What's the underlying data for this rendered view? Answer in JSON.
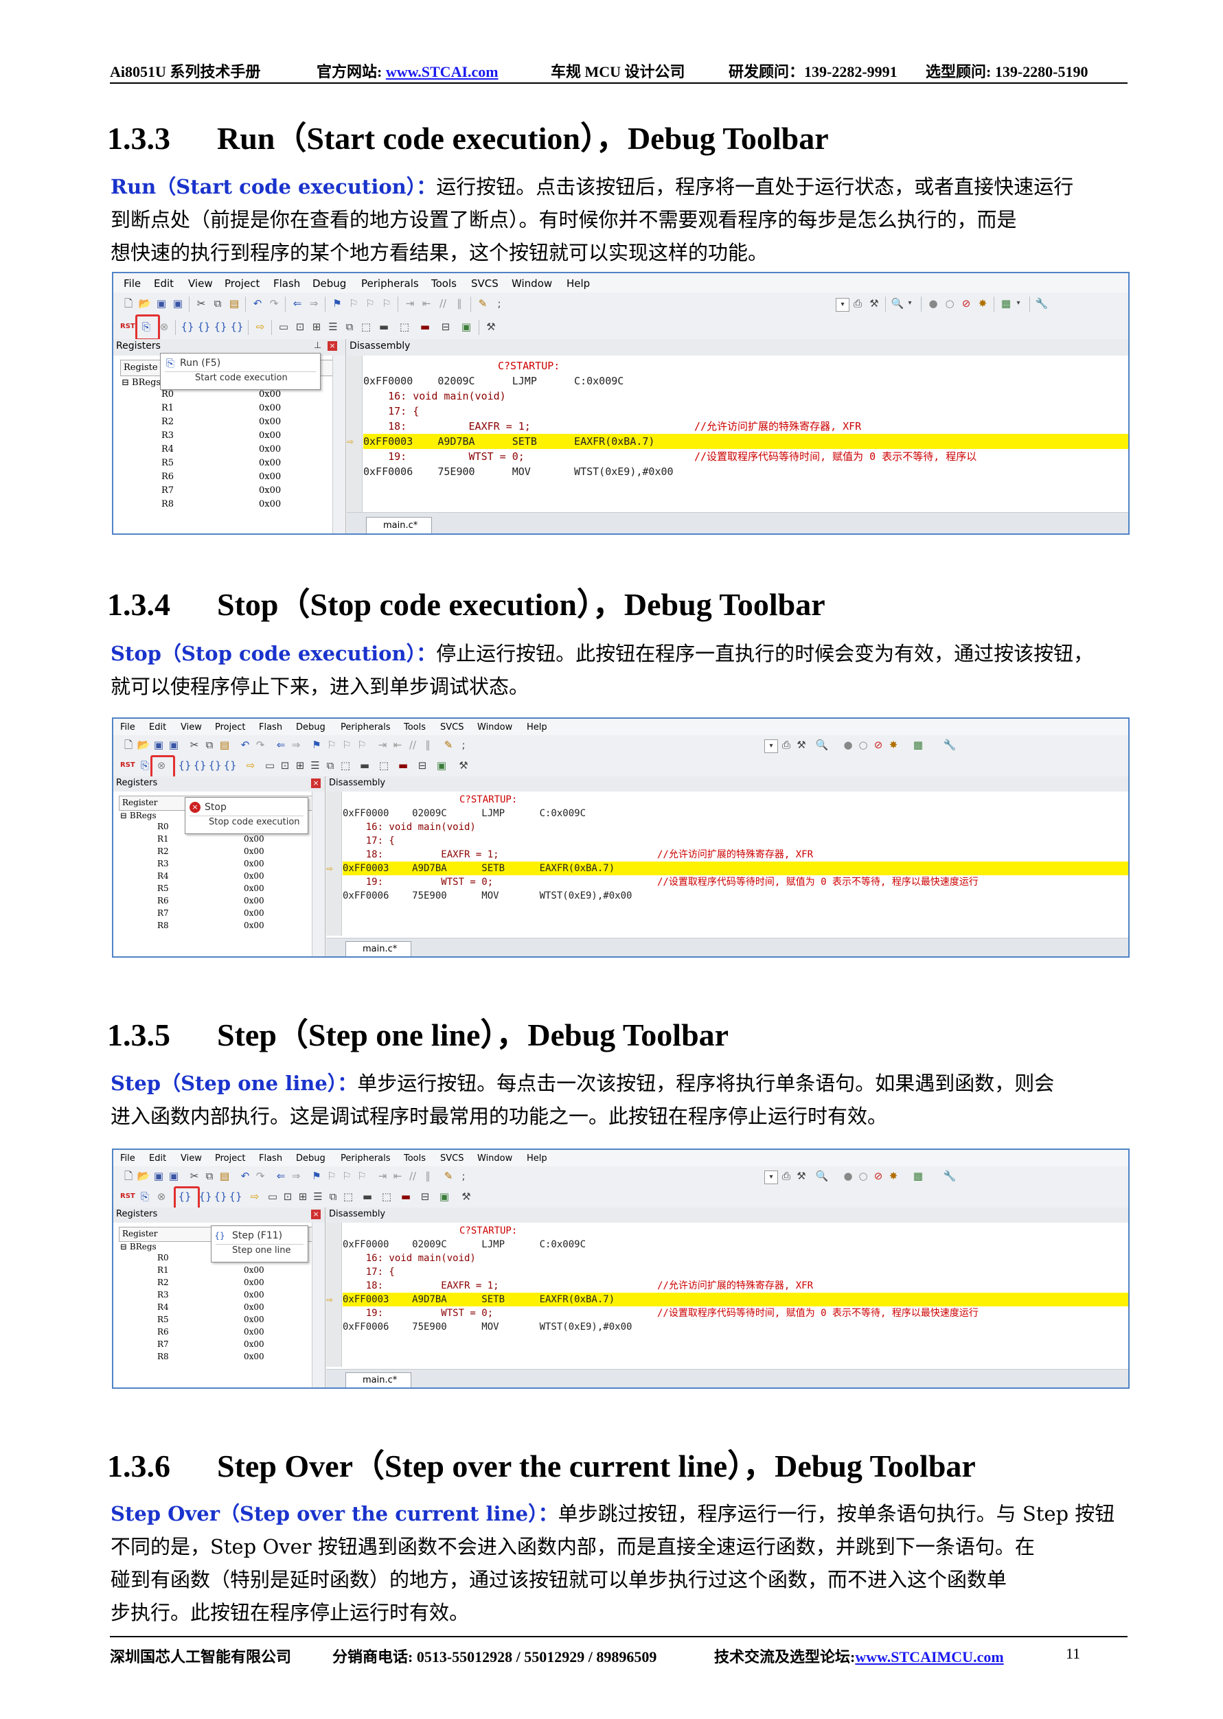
{
  "header": {
    "left": "Ai8051U 系列技术手册",
    "site_label": "官方网站: ",
    "site_link": "www.STCAI.com",
    "company": "车规 MCU 设计公司",
    "rd": "研发顾问：139-2282-9991",
    "sel": "选型顾问: 139-2280-5190"
  },
  "footer": {
    "company": "深圳国芯人工智能有限公司",
    "phone": "分销商电话: 0513-55012928 / 55012929 / 89896509",
    "forum_label": "技术交流及选型论坛:",
    "forum_link": "www.STCAIMCU.com",
    "page": "11"
  },
  "sections": [
    {
      "num": "1.3.3",
      "title": "Run（Start code execution），Debug Toolbar",
      "kw": "Run（Start code execution）：",
      "lines": [
        "运行按钮。点击该按钮后，程序将一直处于运行状态，或者直接快速运行",
        "到断点处（前提是你在查看的地方设置了断点）。有时候你并不需要观看程序的每步是怎么执行的，而是",
        "想快速的执行到程序的某个地方看结果，这个按钮就可以实现这样的功能。"
      ]
    },
    {
      "num": "1.3.4",
      "title": "Stop（Stop code execution），Debug Toolbar",
      "kw": "Stop（Stop code execution）：",
      "lines": [
        "停止运行按钮。此按钮在程序一直执行的时候会变为有效，通过按该按钮，",
        "就可以使程序停止下来，进入到单步调试状态。"
      ]
    },
    {
      "num": "1.3.5",
      "title": "Step（Step one line），Debug Toolbar",
      "kw": "Step（Step one line）：",
      "lines": [
        "单步运行按钮。每点击一次该按钮，程序将执行单条语句。如果遇到函数，则会",
        "进入函数内部执行。这是调试程序时最常用的功能之一。此按钮在程序停止运行时有效。"
      ]
    },
    {
      "num": "1.3.6",
      "title": "Step Over（Step over the current line），Debug Toolbar",
      "kw": "Step Over（Step over the current line）：",
      "lines": [
        "单步跳过按钮，程序运行一行，按单条语句执行。与 Step 按钮",
        "不同的是，Step Over 按钮遇到函数不会进入函数内部，而是直接全速运行函数，并跳到下一条语句。在",
        "碰到有函数（特别是延时函数）的地方，通过该按钮就可以单步执行过这个函数，而不进入这个函数单",
        "步执行。此按钮在程序停止运行时有效。"
      ]
    }
  ],
  "ide": {
    "menu": [
      "File",
      "Edit",
      "View",
      "Project",
      "Flash",
      "Debug",
      "Peripherals",
      "Tools",
      "SVCS",
      "Window",
      "Help"
    ],
    "registers_title": "Registers",
    "register_col": "Register",
    "register_col_cut": "Registe",
    "disassembly_title": "Disassembly",
    "bregs": "BRegs",
    "regs": [
      {
        "name": "R0",
        "val": "0x00"
      },
      {
        "name": "R1",
        "val": "0x00"
      },
      {
        "name": "R2",
        "val": "0x00"
      },
      {
        "name": "R3",
        "val": "0x00"
      },
      {
        "name": "R4",
        "val": "0x00"
      },
      {
        "name": "R5",
        "val": "0x00"
      },
      {
        "name": "R6",
        "val": "0x00"
      },
      {
        "name": "R7",
        "val": "0x00"
      },
      {
        "name": "R8",
        "val": "0x00"
      }
    ],
    "dis": {
      "label": "C?STARTUP:",
      "l1": "0xFF0000    02009C      LJMP      C:0x009C",
      "l2": "    16: void main(void)",
      "l3": "    17: {",
      "l4a": "    18:          EAXFR = 1;",
      "l4b": "//允许访问扩展的特殊寄存器, XFR",
      "l5": "0xFF0003    A9D7BA      SETB      EAXFR(0xBA.7)",
      "l6a": "    19:          WTST = 0;",
      "l6b_1": "//设置取程序代码等待时间, 赋值为 0 表示不等待, 程序以",
      "l6b_2": "//设置取程序代码等待时间, 赋值为 0 表示不等待, 程序以最快速度运行",
      "l7": "0xFF0006    75E900      MOV       WTST(0xE9),#0x00"
    },
    "tab": "main.c*",
    "tips": {
      "run_1": "Run (F5)",
      "run_2": "Start code execution",
      "stop_1": "Stop",
      "stop_2": "Stop code execution",
      "step_1": "Step (F11)",
      "step_2": "Step one line"
    },
    "rst_label": "RST"
  }
}
